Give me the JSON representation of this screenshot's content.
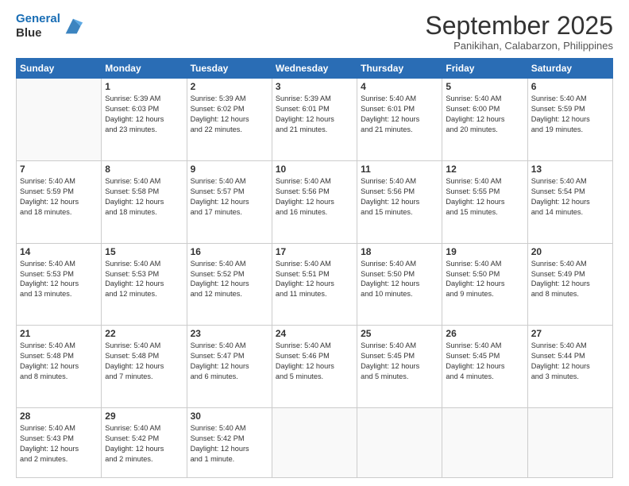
{
  "header": {
    "logo_line1": "General",
    "logo_line2": "Blue",
    "month": "September 2025",
    "location": "Panikihan, Calabarzon, Philippines"
  },
  "days_of_week": [
    "Sunday",
    "Monday",
    "Tuesday",
    "Wednesday",
    "Thursday",
    "Friday",
    "Saturday"
  ],
  "weeks": [
    [
      {
        "day": "",
        "info": ""
      },
      {
        "day": "1",
        "info": "Sunrise: 5:39 AM\nSunset: 6:03 PM\nDaylight: 12 hours\nand 23 minutes."
      },
      {
        "day": "2",
        "info": "Sunrise: 5:39 AM\nSunset: 6:02 PM\nDaylight: 12 hours\nand 22 minutes."
      },
      {
        "day": "3",
        "info": "Sunrise: 5:39 AM\nSunset: 6:01 PM\nDaylight: 12 hours\nand 21 minutes."
      },
      {
        "day": "4",
        "info": "Sunrise: 5:40 AM\nSunset: 6:01 PM\nDaylight: 12 hours\nand 21 minutes."
      },
      {
        "day": "5",
        "info": "Sunrise: 5:40 AM\nSunset: 6:00 PM\nDaylight: 12 hours\nand 20 minutes."
      },
      {
        "day": "6",
        "info": "Sunrise: 5:40 AM\nSunset: 5:59 PM\nDaylight: 12 hours\nand 19 minutes."
      }
    ],
    [
      {
        "day": "7",
        "info": "Sunrise: 5:40 AM\nSunset: 5:59 PM\nDaylight: 12 hours\nand 18 minutes."
      },
      {
        "day": "8",
        "info": "Sunrise: 5:40 AM\nSunset: 5:58 PM\nDaylight: 12 hours\nand 18 minutes."
      },
      {
        "day": "9",
        "info": "Sunrise: 5:40 AM\nSunset: 5:57 PM\nDaylight: 12 hours\nand 17 minutes."
      },
      {
        "day": "10",
        "info": "Sunrise: 5:40 AM\nSunset: 5:56 PM\nDaylight: 12 hours\nand 16 minutes."
      },
      {
        "day": "11",
        "info": "Sunrise: 5:40 AM\nSunset: 5:56 PM\nDaylight: 12 hours\nand 15 minutes."
      },
      {
        "day": "12",
        "info": "Sunrise: 5:40 AM\nSunset: 5:55 PM\nDaylight: 12 hours\nand 15 minutes."
      },
      {
        "day": "13",
        "info": "Sunrise: 5:40 AM\nSunset: 5:54 PM\nDaylight: 12 hours\nand 14 minutes."
      }
    ],
    [
      {
        "day": "14",
        "info": "Sunrise: 5:40 AM\nSunset: 5:53 PM\nDaylight: 12 hours\nand 13 minutes."
      },
      {
        "day": "15",
        "info": "Sunrise: 5:40 AM\nSunset: 5:53 PM\nDaylight: 12 hours\nand 12 minutes."
      },
      {
        "day": "16",
        "info": "Sunrise: 5:40 AM\nSunset: 5:52 PM\nDaylight: 12 hours\nand 12 minutes."
      },
      {
        "day": "17",
        "info": "Sunrise: 5:40 AM\nSunset: 5:51 PM\nDaylight: 12 hours\nand 11 minutes."
      },
      {
        "day": "18",
        "info": "Sunrise: 5:40 AM\nSunset: 5:50 PM\nDaylight: 12 hours\nand 10 minutes."
      },
      {
        "day": "19",
        "info": "Sunrise: 5:40 AM\nSunset: 5:50 PM\nDaylight: 12 hours\nand 9 minutes."
      },
      {
        "day": "20",
        "info": "Sunrise: 5:40 AM\nSunset: 5:49 PM\nDaylight: 12 hours\nand 8 minutes."
      }
    ],
    [
      {
        "day": "21",
        "info": "Sunrise: 5:40 AM\nSunset: 5:48 PM\nDaylight: 12 hours\nand 8 minutes."
      },
      {
        "day": "22",
        "info": "Sunrise: 5:40 AM\nSunset: 5:48 PM\nDaylight: 12 hours\nand 7 minutes."
      },
      {
        "day": "23",
        "info": "Sunrise: 5:40 AM\nSunset: 5:47 PM\nDaylight: 12 hours\nand 6 minutes."
      },
      {
        "day": "24",
        "info": "Sunrise: 5:40 AM\nSunset: 5:46 PM\nDaylight: 12 hours\nand 5 minutes."
      },
      {
        "day": "25",
        "info": "Sunrise: 5:40 AM\nSunset: 5:45 PM\nDaylight: 12 hours\nand 5 minutes."
      },
      {
        "day": "26",
        "info": "Sunrise: 5:40 AM\nSunset: 5:45 PM\nDaylight: 12 hours\nand 4 minutes."
      },
      {
        "day": "27",
        "info": "Sunrise: 5:40 AM\nSunset: 5:44 PM\nDaylight: 12 hours\nand 3 minutes."
      }
    ],
    [
      {
        "day": "28",
        "info": "Sunrise: 5:40 AM\nSunset: 5:43 PM\nDaylight: 12 hours\nand 2 minutes."
      },
      {
        "day": "29",
        "info": "Sunrise: 5:40 AM\nSunset: 5:42 PM\nDaylight: 12 hours\nand 2 minutes."
      },
      {
        "day": "30",
        "info": "Sunrise: 5:40 AM\nSunset: 5:42 PM\nDaylight: 12 hours\nand 1 minute."
      },
      {
        "day": "",
        "info": ""
      },
      {
        "day": "",
        "info": ""
      },
      {
        "day": "",
        "info": ""
      },
      {
        "day": "",
        "info": ""
      }
    ]
  ]
}
